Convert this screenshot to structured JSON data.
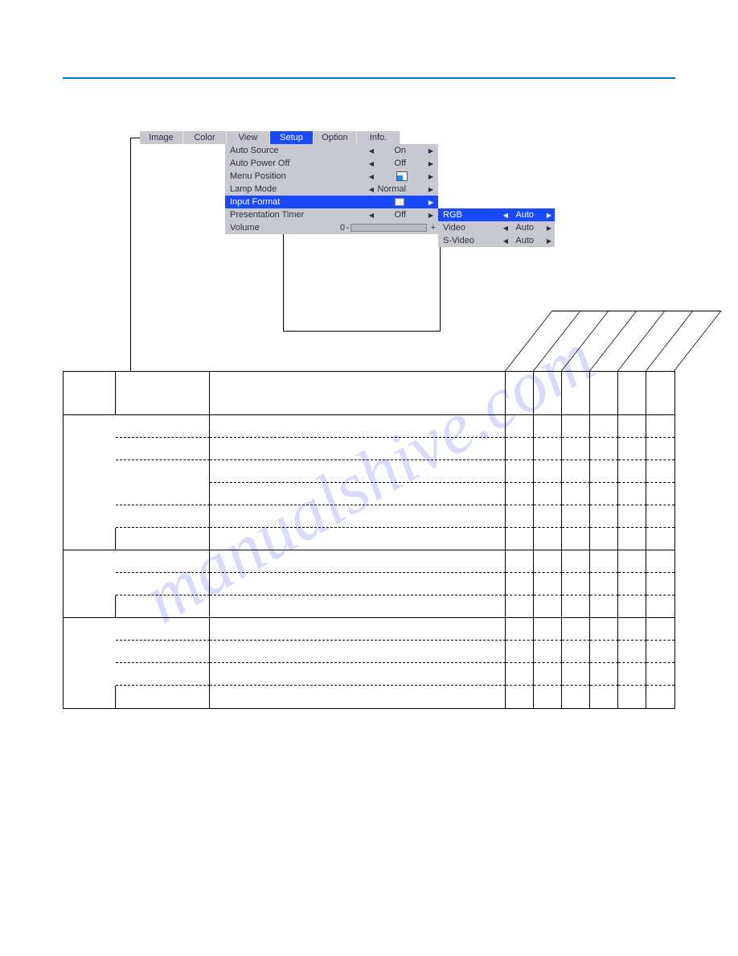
{
  "menu_tabs": [
    "Image",
    "Color",
    "View",
    "Setup",
    "Option",
    "Info."
  ],
  "selected_tab_index": 3,
  "menu_items": [
    {
      "label": "Auto Source",
      "value": "On"
    },
    {
      "label": "Auto Power Off",
      "value": "Off"
    },
    {
      "label": "Menu Position",
      "value": ""
    },
    {
      "label": "Lamp Mode",
      "value": "Normal"
    },
    {
      "label": "Input Format",
      "value": ""
    },
    {
      "label": "Presentation Timer",
      "value": "Off"
    },
    {
      "label": "Volume",
      "value": "0"
    }
  ],
  "selected_item_index": 4,
  "submenu": [
    {
      "label": "RGB",
      "value": "Auto"
    },
    {
      "label": "Video",
      "value": "Auto"
    },
    {
      "label": "S-Video",
      "value": "Auto"
    }
  ],
  "selected_sub_index": 0,
  "watermark": "manualshive.com"
}
